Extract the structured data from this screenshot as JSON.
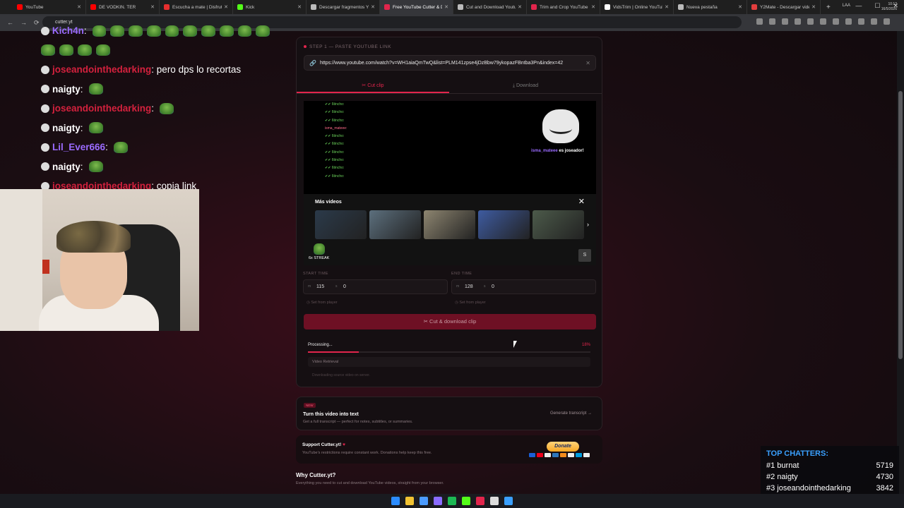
{
  "browser": {
    "tabs": [
      {
        "title": "YouTube",
        "color": "#ff0000",
        "active": false
      },
      {
        "title": "DE VODKIN. TER",
        "color": "#ff0000",
        "active": false
      },
      {
        "title": "Escucha a mate | Disfruta",
        "color": "#e62e2e",
        "active": false
      },
      {
        "title": "Kick",
        "color": "#53fc18",
        "active": false
      },
      {
        "title": "Descargar fragmentos Yo",
        "color": "#bbbbbb",
        "active": false
      },
      {
        "title": "Free YouTube Cutter & D",
        "color": "#e1254c",
        "active": true
      },
      {
        "title": "Cut and Download Youtu",
        "color": "#bbbbbb",
        "active": false
      },
      {
        "title": "Trim and Crop YouTube v",
        "color": "#e1254c",
        "active": false
      },
      {
        "title": "VidsTrim | Online YouTub",
        "color": "#ffffff",
        "active": false
      },
      {
        "title": "Nueva pestaña",
        "color": "#bbbbbb",
        "active": false
      },
      {
        "title": "Y2Mate - Descargar vide",
        "color": "#e13d3d",
        "active": false
      }
    ],
    "url": "cutter.yt"
  },
  "chat": {
    "lines": [
      {
        "user": "Kich4n",
        "sep": ":",
        "msg": "",
        "color": "#9b6bff",
        "emotes": 10
      },
      {
        "user": "",
        "sep": "",
        "msg": "",
        "color": "#ffffff",
        "emotes": 4
      },
      {
        "user": "joseandointhedarking",
        "sep": ":",
        "msg": " pero dps lo recortas",
        "color": "#d4213d",
        "emotes": 0
      },
      {
        "user": "naigty",
        "sep": ":",
        "msg": "",
        "color": "#ffffff",
        "emotes": 1
      },
      {
        "user": "joseandointhedarking",
        "sep": ":",
        "msg": "",
        "color": "#d4213d",
        "emotes": 1
      },
      {
        "user": "naigty",
        "sep": ":",
        "msg": "",
        "color": "#ffffff",
        "emotes": 1
      },
      {
        "user": "Lil_Ever666",
        "sep": ":",
        "msg": "",
        "color": "#9b6bff",
        "emotes": 1
      },
      {
        "user": "naigty",
        "sep": ":",
        "msg": "",
        "color": "#ffffff",
        "emotes": 1
      },
      {
        "user": "joseandointhedarking",
        "sep": ":",
        "msg": " copia link",
        "color": "#d4213d",
        "emotes": 0
      }
    ]
  },
  "app": {
    "step_label": "STEP 1 — PASTE YOUTUBE LINK",
    "url_value": "https://www.youtube.com/watch?v=WH1aiaQmTwQ&list=PLM141zpse4jDzBbw79ykopazFBntba3Pn&index=42",
    "tabs": {
      "cut": "Cut clip",
      "download": "Download"
    },
    "player": {
      "mini_chat": [
        {
          "text": "✔✔ 6tincho:",
          "cls": "g"
        },
        {
          "text": "✔✔ 6tincho:",
          "cls": "g"
        },
        {
          "text": "✔✔ 6tincho:",
          "cls": "g"
        },
        {
          "text": "isma_mateee:",
          "cls": "p"
        },
        {
          "text": "✔✔ 6tincho:",
          "cls": "g"
        },
        {
          "text": "✔✔ 6tincho:",
          "cls": "g"
        },
        {
          "text": "✔✔ 6tincho:",
          "cls": "g"
        },
        {
          "text": "✔✔ 6tincho:",
          "cls": "g"
        },
        {
          "text": "✔✔ 6tincho:",
          "cls": "g"
        },
        {
          "text": "✔✔ 6tincho:",
          "cls": "g"
        }
      ],
      "alert_name": "isma_mateee",
      "alert_text": " es joseador!",
      "more_videos": "Más videos",
      "streak": "6x STREAK",
      "s_button": "S",
      "thumbs": [
        "#2b3a4a",
        "#5c6f7d",
        "#8d8570",
        "#3e5ba0",
        "#4c5a4a"
      ]
    },
    "start_time_label": "START TIME",
    "end_time_label": "END TIME",
    "start": {
      "min": "115",
      "sec": "0"
    },
    "end": {
      "min": "128",
      "sec": "0"
    },
    "time_prefix": "m",
    "time_colon": "s",
    "set_from_player": "Set from player",
    "cut_button": "Cut & download clip",
    "processing_label": "Processing...",
    "processing_pct": "18%",
    "processing_value": 0.18,
    "stage_label": "Video Retrieval",
    "stage_sub": "Downloading source video on server.",
    "transcript": {
      "tag": "NEW",
      "title": "Turn this video into text",
      "sub": "Get a full transcript — perfect for notes, subtitles, or summaries.",
      "link": "Generate transcript →"
    },
    "support": {
      "title": "Support Cutter.yt!",
      "sub": "YouTube's restrictions require constant work. Donations help keep this free.",
      "donate": "Donate"
    },
    "why_title": "Why Cutter.yt?",
    "why_sub": "Everything you need to cut and download YouTube videos, straight from your browser."
  },
  "top_chatters": {
    "title": "TOP CHATTERS:",
    "rows": [
      {
        "rank": "#1 burnat",
        "count": "5719"
      },
      {
        "rank": "#2 naigty",
        "count": "4730"
      },
      {
        "rank": "#3 joseandointhedarking",
        "count": "3842"
      }
    ]
  },
  "taskbar": {
    "lang": "LAA",
    "time": "10:13",
    "date": "16/5/2026",
    "icons": [
      "#2b8cff",
      "#f1c232",
      "#4b9bff",
      "#8a6bff",
      "#1db954",
      "#53fc18",
      "#e1254c",
      "#dddddd",
      "#3aa0ff"
    ]
  },
  "colors": {
    "accent": "#e1254c",
    "accent_dark": "#6e1024",
    "chatters_title": "#3aa0ff"
  }
}
